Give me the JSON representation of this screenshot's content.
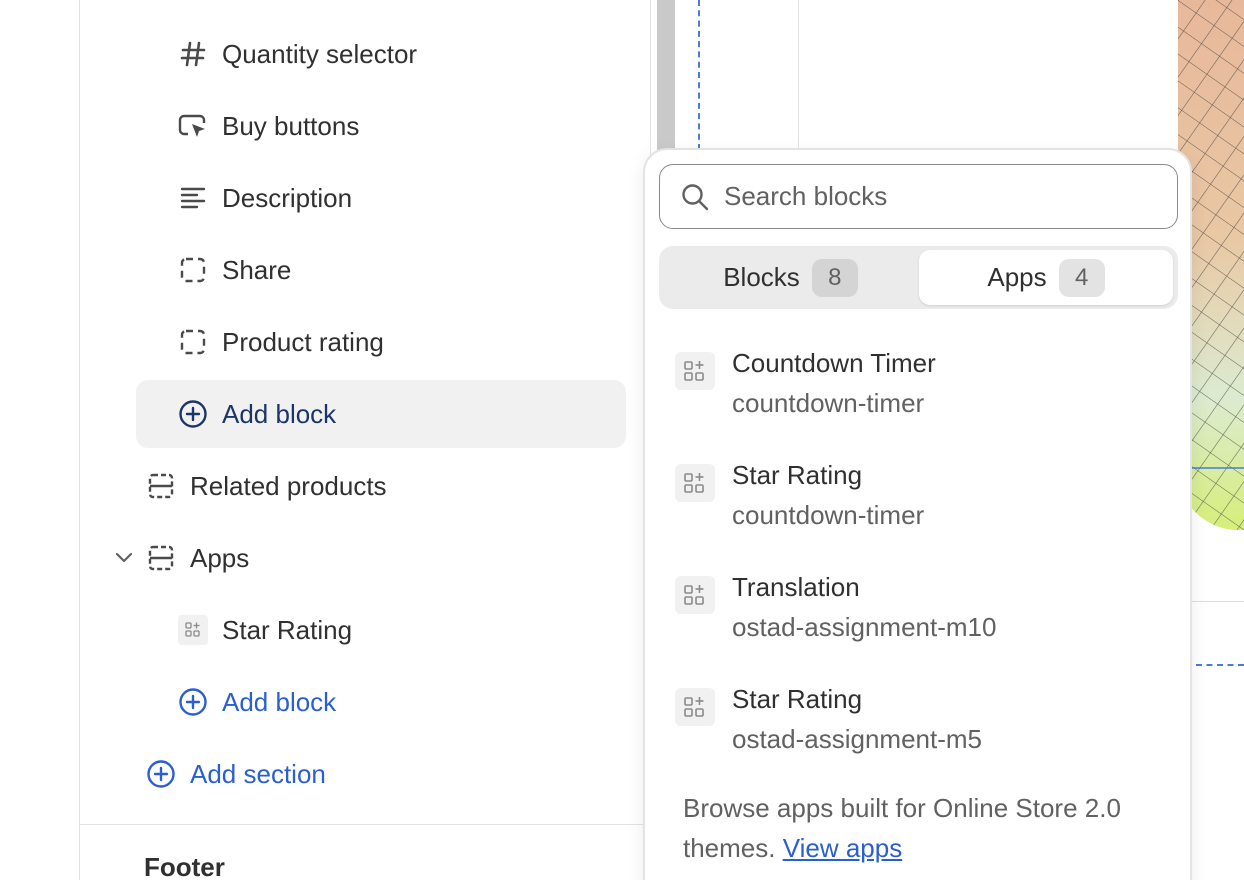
{
  "sidebar": {
    "items": [
      {
        "label": "Quantity selector",
        "icon": "hash-icon"
      },
      {
        "label": "Buy buttons",
        "icon": "cursor-button-icon"
      },
      {
        "label": "Description",
        "icon": "text-align-left-icon"
      },
      {
        "label": "Share",
        "icon": "dashed-square-icon"
      },
      {
        "label": "Product rating",
        "icon": "dashed-square-icon"
      },
      {
        "label": "Add block",
        "icon": "plus-circle-icon"
      },
      {
        "label": "Related products",
        "icon": "section-icon"
      },
      {
        "label": "Apps",
        "icon": "section-icon"
      },
      {
        "label": "Star Rating",
        "icon": "app-block-icon"
      },
      {
        "label": "Add block",
        "icon": "plus-circle-icon"
      },
      {
        "label": "Add section",
        "icon": "plus-circle-icon"
      }
    ],
    "footer_label": "Footer"
  },
  "popover": {
    "search": {
      "placeholder": "Search blocks",
      "value": ""
    },
    "tabs": [
      {
        "label": "Blocks",
        "count": "8",
        "selected": false
      },
      {
        "label": "Apps",
        "count": "4",
        "selected": true
      }
    ],
    "apps": [
      {
        "name": "Countdown Timer",
        "handle": "countdown-timer"
      },
      {
        "name": "Star Rating",
        "handle": "countdown-timer"
      },
      {
        "name": "Translation",
        "handle": "ostad-assignment-m10"
      },
      {
        "name": "Star Rating",
        "handle": "ostad-assignment-m5"
      }
    ],
    "browse_text": "Browse apps built for Online Store 2.0 themes.",
    "view_apps_link": "View apps"
  },
  "colors": {
    "link": "#2a5fd1",
    "active_row_bg": "#f1f1f1",
    "text_primary": "#303030",
    "text_secondary": "#616161"
  }
}
